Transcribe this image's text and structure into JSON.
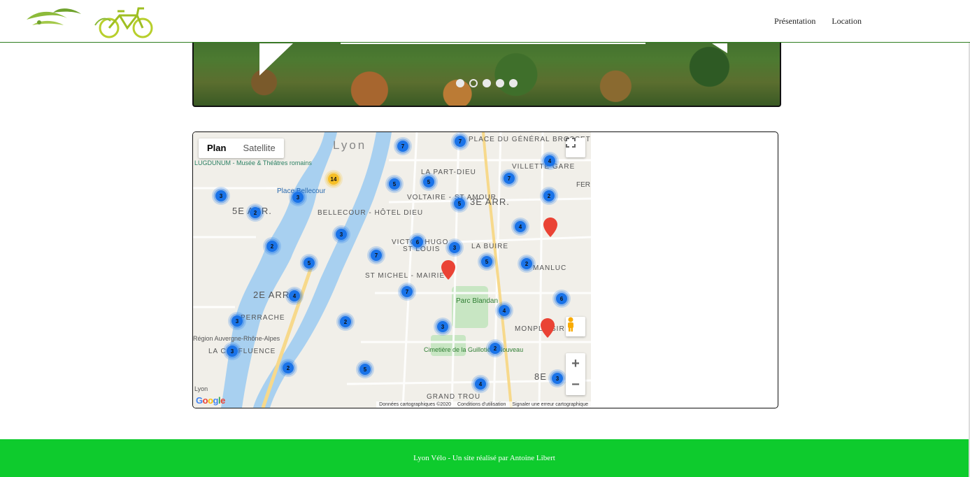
{
  "header": {
    "nav": [
      "Présentation",
      "Location"
    ]
  },
  "slider": {
    "dots_count": 5,
    "active_dot": 2
  },
  "map": {
    "map_type_buttons": [
      "Plan",
      "Satellite"
    ],
    "selected_map_type": "Plan",
    "zoom_in": "+",
    "zoom_out": "−",
    "attribution": [
      "Données cartographiques ©2020",
      "Conditions d'utilisation",
      "Signaler une erreur cartographique"
    ],
    "google_logo": "Google",
    "place_labels": [
      "Lyon",
      "PLACE DU GÉNÉRAL BROSSET",
      "LA PART-DIEU",
      "VILLETTE GARE",
      "FER",
      "LUGDUNUM - Musée & Théâtres romains",
      "Place Bellecour",
      "VOLTAIRE - ST AMOUR",
      "3E ARR.",
      "5E ARR.",
      "BELLECOUR - HÔTEL DIEU",
      "VICTOR HUGO",
      "ST LOUIS",
      "LA BUIRE",
      "MANLUC",
      "2E ARR.",
      "ST MICHEL - MAIRIE",
      "PERRACHE",
      "Région Auvergne-Rhône-Alpes",
      "LA CONFLUENCE",
      "Parc Blandan",
      "MONPLAISIR",
      "Cimetière de la Guillotière Nouveau",
      "8E",
      "GRAND TROU",
      "Lyon"
    ],
    "clusters": [
      {
        "count": 7,
        "color": "blue"
      },
      {
        "count": 7,
        "color": "blue"
      },
      {
        "count": 4,
        "color": "blue"
      },
      {
        "count": 14,
        "color": "yellow"
      },
      {
        "count": 5,
        "color": "blue"
      },
      {
        "count": 5,
        "color": "blue"
      },
      {
        "count": 7,
        "color": "blue"
      },
      {
        "count": 3,
        "color": "blue"
      },
      {
        "count": 3,
        "color": "blue"
      },
      {
        "count": 2,
        "color": "blue"
      },
      {
        "count": 5,
        "color": "blue"
      },
      {
        "count": 2,
        "color": "blue"
      },
      {
        "count": 3,
        "color": "blue"
      },
      {
        "count": 4,
        "color": "blue"
      },
      {
        "count": 2,
        "color": "blue"
      },
      {
        "count": 6,
        "color": "blue"
      },
      {
        "count": 3,
        "color": "blue"
      },
      {
        "count": 7,
        "color": "blue"
      },
      {
        "count": 5,
        "color": "blue"
      },
      {
        "count": 5,
        "color": "blue"
      },
      {
        "count": 2,
        "color": "blue"
      },
      {
        "count": 4,
        "color": "blue"
      },
      {
        "count": 7,
        "color": "blue"
      },
      {
        "count": 6,
        "color": "blue"
      },
      {
        "count": 3,
        "color": "blue"
      },
      {
        "count": 2,
        "color": "blue"
      },
      {
        "count": 4,
        "color": "blue"
      },
      {
        "count": 3,
        "color": "blue"
      },
      {
        "count": 3,
        "color": "blue"
      },
      {
        "count": 2,
        "color": "blue"
      },
      {
        "count": 2,
        "color": "blue"
      },
      {
        "count": 5,
        "color": "blue"
      },
      {
        "count": 4,
        "color": "blue"
      },
      {
        "count": 3,
        "color": "blue"
      }
    ]
  },
  "footer": {
    "text": "Lyon Vélo - Un site réalisé par Antoine Libert"
  },
  "colors": {
    "footer_bg": "#0ecb2d",
    "header_border": "#2e7d1f",
    "cluster_blue": "#1a73e8",
    "cluster_yellow": "#f6bf26",
    "marker_red": "#ea4335"
  }
}
